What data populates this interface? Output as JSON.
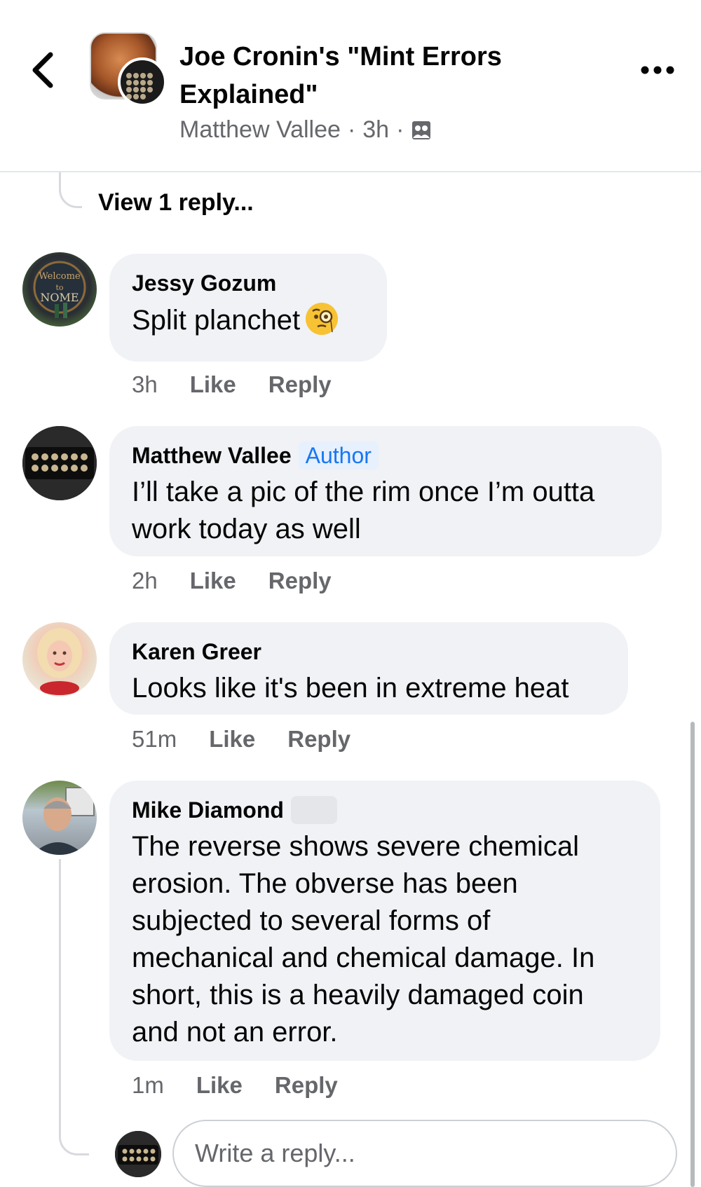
{
  "header": {
    "back_icon": "chevron-left-icon",
    "group_title": "Joe Cronin's \"Mint Errors Explained\"",
    "author": "Matthew Vallee",
    "separator": "·",
    "time": "3h",
    "audience_icon": "group-audience-icon",
    "more_icon": "more-horizontal-icon"
  },
  "thread": {
    "view_replies_label": "View 1 reply..."
  },
  "comments": [
    {
      "name": "Jessy Gozum",
      "text": "Split planchet",
      "emoji": "face-with-monocle-emoji",
      "time": "3h",
      "like_label": "Like",
      "reply_label": "Reply"
    },
    {
      "name": "Matthew Vallee",
      "badge": "Author",
      "text": "I’ll take a pic of the rim once I’m outta work today as well",
      "time": "2h",
      "like_label": "Like",
      "reply_label": "Reply"
    },
    {
      "name": "Karen Greer",
      "text": "Looks like it's been in extreme heat",
      "time": "51m",
      "like_label": "Like",
      "reply_label": "Reply"
    },
    {
      "name": "Mike Diamond",
      "text": "The reverse shows severe chemical erosion.  The obverse has been subjected to several forms of mechanical and chemical damage.  In short, this is a heavily damaged coin and not an error.",
      "time": "1m",
      "like_label": "Like",
      "reply_label": "Reply"
    }
  ],
  "composer": {
    "placeholder": "Write a reply..."
  },
  "colors": {
    "bubble": "#f0f2f5",
    "secondary_text": "#65676b",
    "author_badge_text": "#1877f2",
    "author_badge_bg": "#e7f0fd"
  }
}
